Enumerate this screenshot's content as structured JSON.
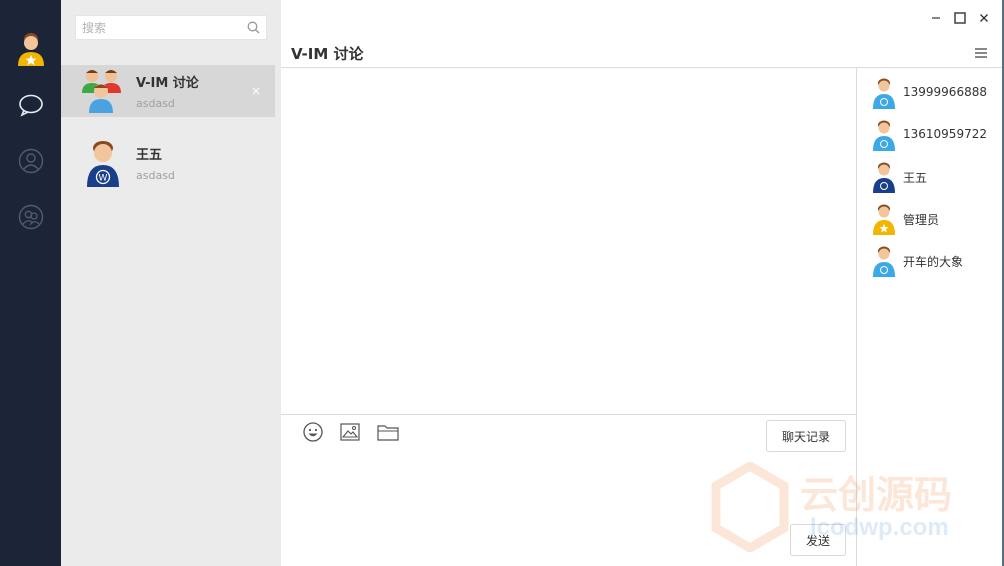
{
  "window": {
    "title": "V-IM 讨论",
    "controls": {
      "minimize": "–",
      "maximize": "☐",
      "close": "×"
    }
  },
  "nav": {
    "user_avatar": "user-star-avatar",
    "items": [
      {
        "name": "chat",
        "icon": "chat-bubble-icon",
        "active": true
      },
      {
        "name": "contacts",
        "icon": "person-icon",
        "active": false
      },
      {
        "name": "groups",
        "icon": "group-icon",
        "active": false
      }
    ]
  },
  "search": {
    "placeholder": "搜索",
    "value": ""
  },
  "conversations": [
    {
      "name": "V-IM 讨论",
      "last_message": "asdasd",
      "avatar": "group-avatar",
      "active": true,
      "close": "×"
    },
    {
      "name": "王五",
      "last_message": "asdasd",
      "avatar": "wordpress-avatar",
      "active": false
    }
  ],
  "toolbar": {
    "emoji": "emoji-icon",
    "image": "image-icon",
    "file": "folder-icon",
    "history_label": "聊天记录",
    "send_label": "发送"
  },
  "members": [
    {
      "name": "13999966888",
      "avatar": "blue-avatar"
    },
    {
      "name": "13610959722",
      "avatar": "blue-avatar"
    },
    {
      "name": "王五",
      "avatar": "wordpress-avatar"
    },
    {
      "name": "管理员",
      "avatar": "star-avatar"
    },
    {
      "name": "开车的大象",
      "avatar": "blue-avatar"
    }
  ],
  "watermark": {
    "text": "云创源码",
    "sub": "lcodwp.com"
  },
  "colors": {
    "nav_bg": "#1c2438",
    "list_bg": "#ebebeb",
    "active_item": "#d7d7d7",
    "divider": "#dcdcdc"
  }
}
